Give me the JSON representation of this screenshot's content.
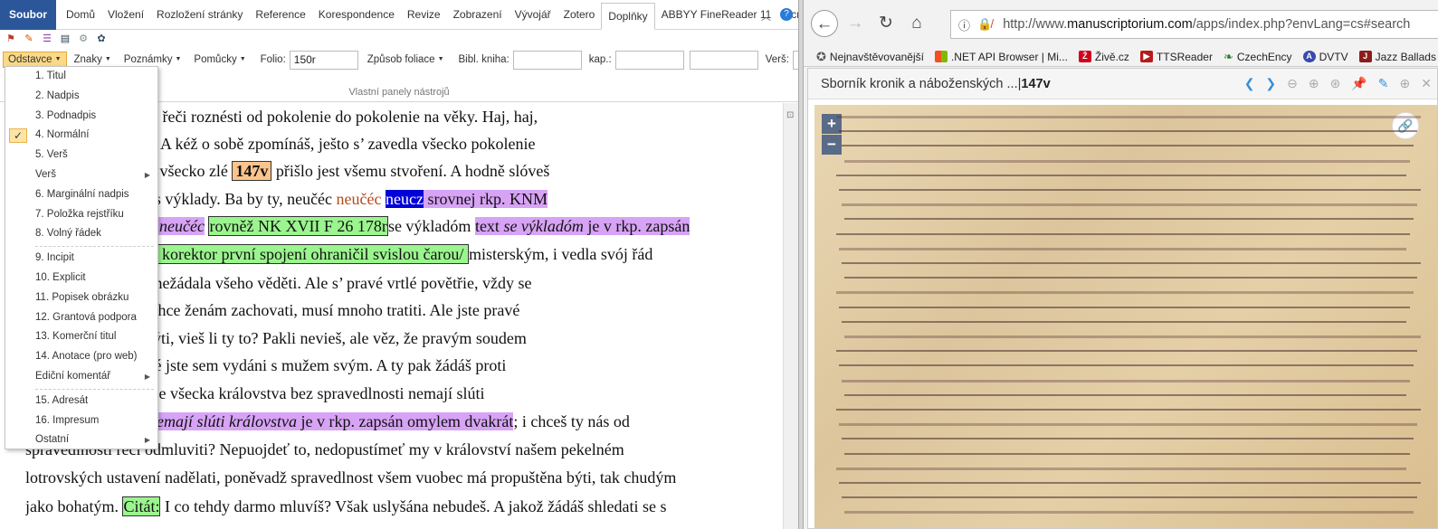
{
  "word": {
    "tabs": [
      "Soubor",
      "Domů",
      "Vložení",
      "Rozložení stránky",
      "Reference",
      "Korespondence",
      "Revize",
      "Zobrazení",
      "Vývojář",
      "Zotero",
      "Doplňky",
      "ABBYY FineReader 11",
      "Acrobat"
    ],
    "active_tab": "Doplňky",
    "toolbar": {
      "odstavce": "Odstavce",
      "znaky": "Znaky",
      "poznamky": "Poznámky",
      "pomucky": "Pomůcky",
      "folio_label": "Folio:",
      "folio_value": "150r",
      "zpusob": "Způsob foliace",
      "bibl_label": "Bibl. kniha:",
      "kap_label": "kap.:",
      "vers_label": "Verš:",
      "group_label": "Vlastní panely nástrojů"
    },
    "menu": [
      {
        "label": "1. Titul"
      },
      {
        "label": "2. Nadpis"
      },
      {
        "label": "3. Podnadpis"
      },
      {
        "label": "4. Normální",
        "checked": true
      },
      {
        "label": "5. Verš"
      },
      {
        "label": "Verš",
        "submenu": true
      },
      {
        "label": "6. Marginální nadpis"
      },
      {
        "label": "7. Položka rejstříku"
      },
      {
        "label": "8. Volný řádek",
        "separator_after": true
      },
      {
        "label": "9. Incipit"
      },
      {
        "label": "10. Explicit"
      },
      {
        "label": "11. Popisek obrázku"
      },
      {
        "label": "12. Grantová podpora"
      },
      {
        "label": "13. Komerční titul"
      },
      {
        "label": "14. Anotace (pro web)"
      },
      {
        "label": "Ediční komentář",
        "submenu": true,
        "separator_after": true
      },
      {
        "label": "15. Adresát"
      },
      {
        "label": "16. Impresum"
      },
      {
        "label": "Ostatní",
        "submenu": true
      }
    ],
    "doc": {
      "l1": "by se musila pro své řeči roznésti od pokolenie do pokolenie na věky. Haj, haj,",
      "l2": "ká a vykládá jména! A kéž o sobě zpomínáš, ješto s’ zavedla všecko pokolenie",
      "l3a": "v robotu a skrze vás všecko zlé ",
      "l3b": "147v",
      "l3c": " přišlo jest všemu stvoření. A hodně slóveš",
      "l4a": "á, i vyrazila sě také s výklady. Ba by ty, neučéc ",
      "l4b": "neučéc",
      "l4c": " ",
      "l4d": "neucz",
      "l4e": " srovnej rkp. KNM",
      "l5a": "neučéc",
      "l5b": "rovněž NK XVII F 26 178r",
      "l5c": "se výkladóm ",
      "l5d": "text ",
      "l5e": "se výkladóm",
      "l5f": " je v rkp. zapsán",
      "l6a": " korektor první spojení ohraničil svislou čarou/ ",
      "l6b": " misterským, i vedla svój řád",
      "l7": "ie by to bylo, a aby nežádala všeho věděti. Ale s’ pravé vrtlé povětřie, vždy se",
      "l8": "ostí. A věru, kto sě chce ženám zachovati, musí mnoho tratiti. Ale jste pravé",
      "l9": "i mohú jiní lapáni býti, vieš li ty to? Pakli nevieš, ale věz, že pravým soudem",
      "l10": "spravedlnosti božské jste sem vydáni s mužem svým. A ty pak žádáš proti",
      "l11": "roštěnie. Vieš li to, že všecka královstva bez spravedlnosti nemají slúti",
      "l12a": "emají slúti královstva",
      "l12b": " je v rkp. zapsán omylem dvakrát",
      "l12c": "; i chceš ty nás od",
      "l13": "spravedlnosti řečí odmluviti? Nepuojdeť to, nedopustímeť my v království našem pekelném",
      "l14": "lotrovských ustavení nadělati, poněvadž spravedlnost všem vuobec má propuštěna býti, tak chudým",
      "l15a": "jako bohatým. ",
      "l15b": "Citát:",
      "l15c": " I co tehdy darmo mluvíš? Však uslyšána nebudeš. A jakož žádáš shledati se s"
    }
  },
  "browser": {
    "url_prefix": "http://www.",
    "url_domain": "manuscriptorium.com",
    "url_rest": "/apps/index.php?envLang=cs#search",
    "bookmarks": [
      {
        "label": "Nejnavštěvovanější",
        "icon": "star-icon",
        "color": "#555"
      },
      {
        "label": ".NET API Browser | Mi...",
        "icon": "windows-icon",
        "color": "#f25022"
      },
      {
        "label": "Živě.cz",
        "icon": "zive-icon",
        "color": "#d0021b"
      },
      {
        "label": "TTSReader",
        "icon": "tts-icon",
        "color": "#b71c1c"
      },
      {
        "label": "CzechEncy",
        "icon": "leaf-icon",
        "color": "#2e7d32"
      },
      {
        "label": "DVTV",
        "icon": "dvtv-icon",
        "color": "#3949ab"
      },
      {
        "label": "Jazz Ballads",
        "icon": "jazz-icon",
        "color": "#8d1c1c"
      }
    ],
    "viewer_title": "Sborník kronik a náboženských ...",
    "viewer_sep": " | ",
    "viewer_folio": "147v"
  }
}
